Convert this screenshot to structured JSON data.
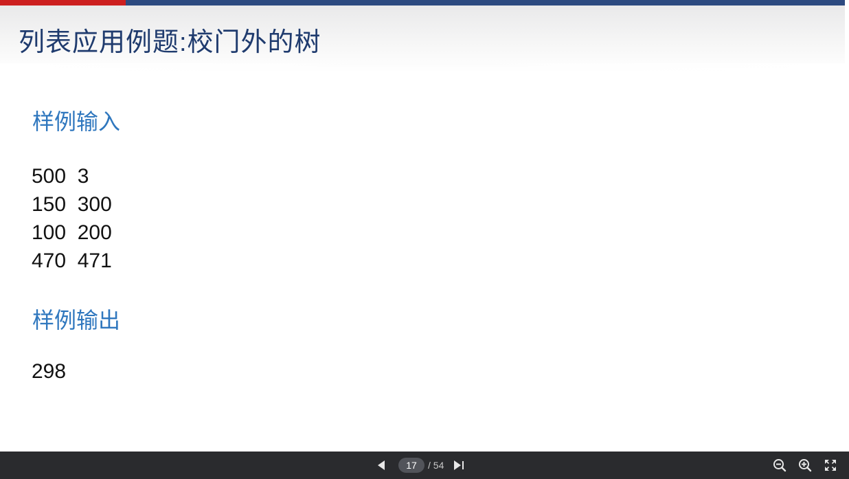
{
  "slide": {
    "title": "列表应用例题:校门外的树",
    "input_heading": "样例输入",
    "input_lines": [
      "500  3",
      "150  300",
      "100  200",
      "470  471"
    ],
    "output_heading": "样例输出",
    "output_value": "298"
  },
  "toolbar": {
    "current_page": "17",
    "total_pages": "/ 54",
    "icons": [
      "prev-page-icon",
      "next-page-icon",
      "zoom-out-icon",
      "zoom-in-icon",
      "fullscreen-icon"
    ]
  },
  "colors": {
    "title": "#1f3b6e",
    "heading": "#2f77be",
    "top_bar_blue": "#2c4a80",
    "top_bar_red": "#cc1f1f",
    "toolbar_bg": "#2a2b2e"
  }
}
